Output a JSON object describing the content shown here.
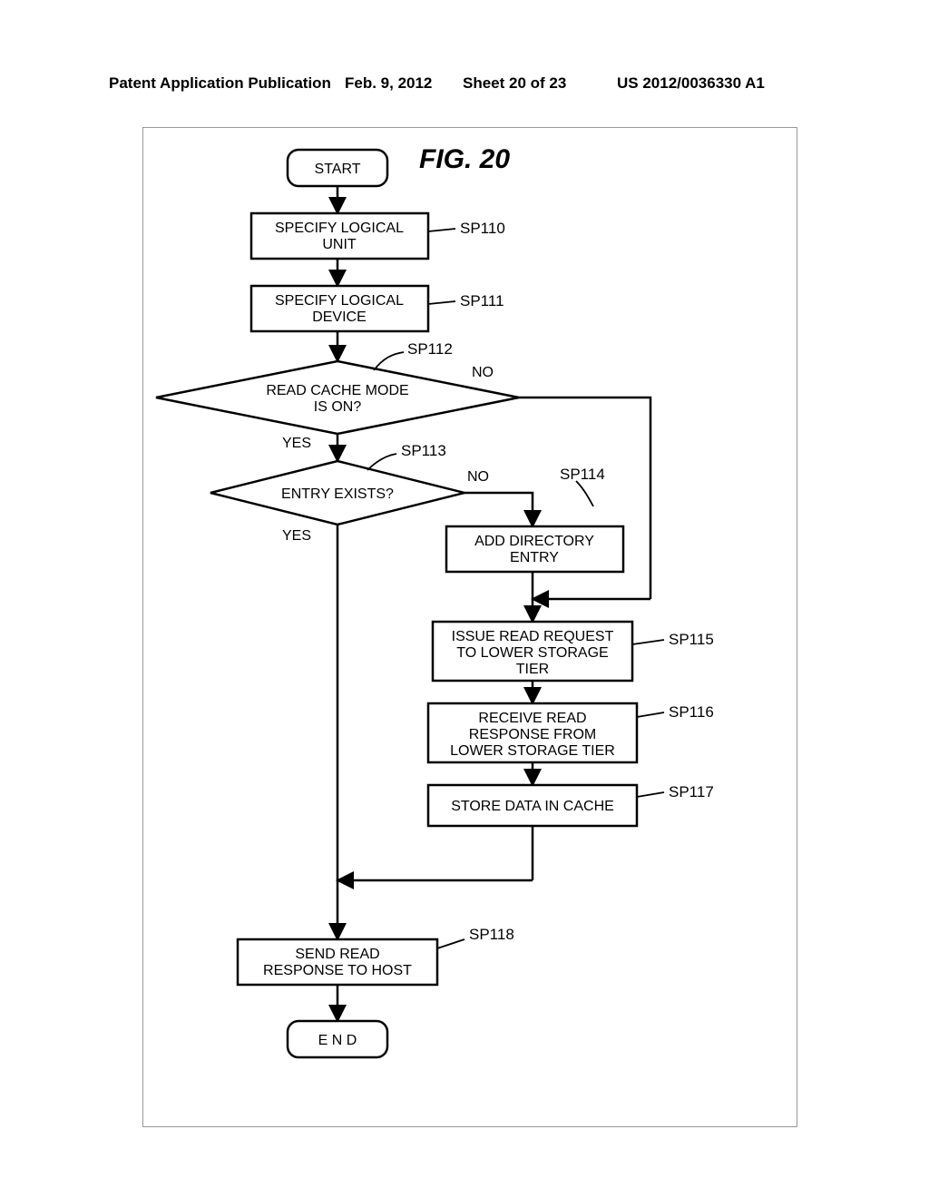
{
  "header": {
    "left": "Patent Application Publication",
    "date": "Feb. 9, 2012",
    "sheet": "Sheet 20 of 23",
    "pubno": "US 2012/0036330 A1"
  },
  "figure_title": "FIG. 20",
  "nodes": {
    "start": "START",
    "sp110": "SPECIFY LOGICAL\nUNIT",
    "sp111": "SPECIFY LOGICAL\nDEVICE",
    "sp112": "READ CACHE MODE\nIS ON?",
    "sp113": "ENTRY EXISTS?",
    "sp114": "ADD DIRECTORY\nENTRY",
    "sp115": "ISSUE READ REQUEST\nTO LOWER STORAGE\nTIER",
    "sp116": "RECEIVE READ\nRESPONSE FROM\nLOWER STORAGE TIER",
    "sp117": "STORE DATA IN CACHE",
    "sp118": "SEND READ\nRESPONSE TO HOST",
    "end": "E N D"
  },
  "labels": {
    "sp110": "SP110",
    "sp111": "SP111",
    "sp112": "SP112",
    "sp113": "SP113",
    "sp114": "SP114",
    "sp115": "SP115",
    "sp116": "SP116",
    "sp117": "SP117",
    "sp118": "SP118"
  },
  "branch": {
    "yes": "YES",
    "no": "NO"
  }
}
